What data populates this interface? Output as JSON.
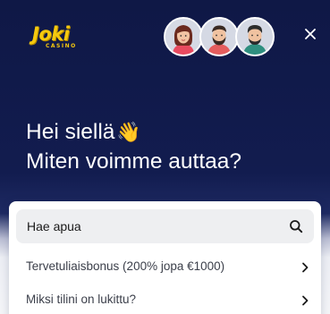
{
  "brand": {
    "logo_word": "Joki",
    "logo_sub": "CASINO"
  },
  "header": {
    "agents": [
      "agent-avatar-1",
      "agent-avatar-2",
      "agent-avatar-3"
    ],
    "close_icon": "close-icon"
  },
  "greeting": {
    "line1": "Hei siellä",
    "wave": "👋",
    "line2": "Miten voimme auttaa?"
  },
  "search": {
    "label": "Hae apua",
    "icon": "search-icon"
  },
  "articles": [
    {
      "label": "Tervetuliaisbonus (200% jopa €1000)",
      "icon": "chevron-right-icon"
    },
    {
      "label": "Miksi tilini on lukittu?",
      "icon": "chevron-right-icon"
    }
  ],
  "colors": {
    "background": "#121c4f",
    "brand_yellow": "#f6c90e",
    "card": "#ffffff",
    "search_bg": "#eeeff1"
  }
}
